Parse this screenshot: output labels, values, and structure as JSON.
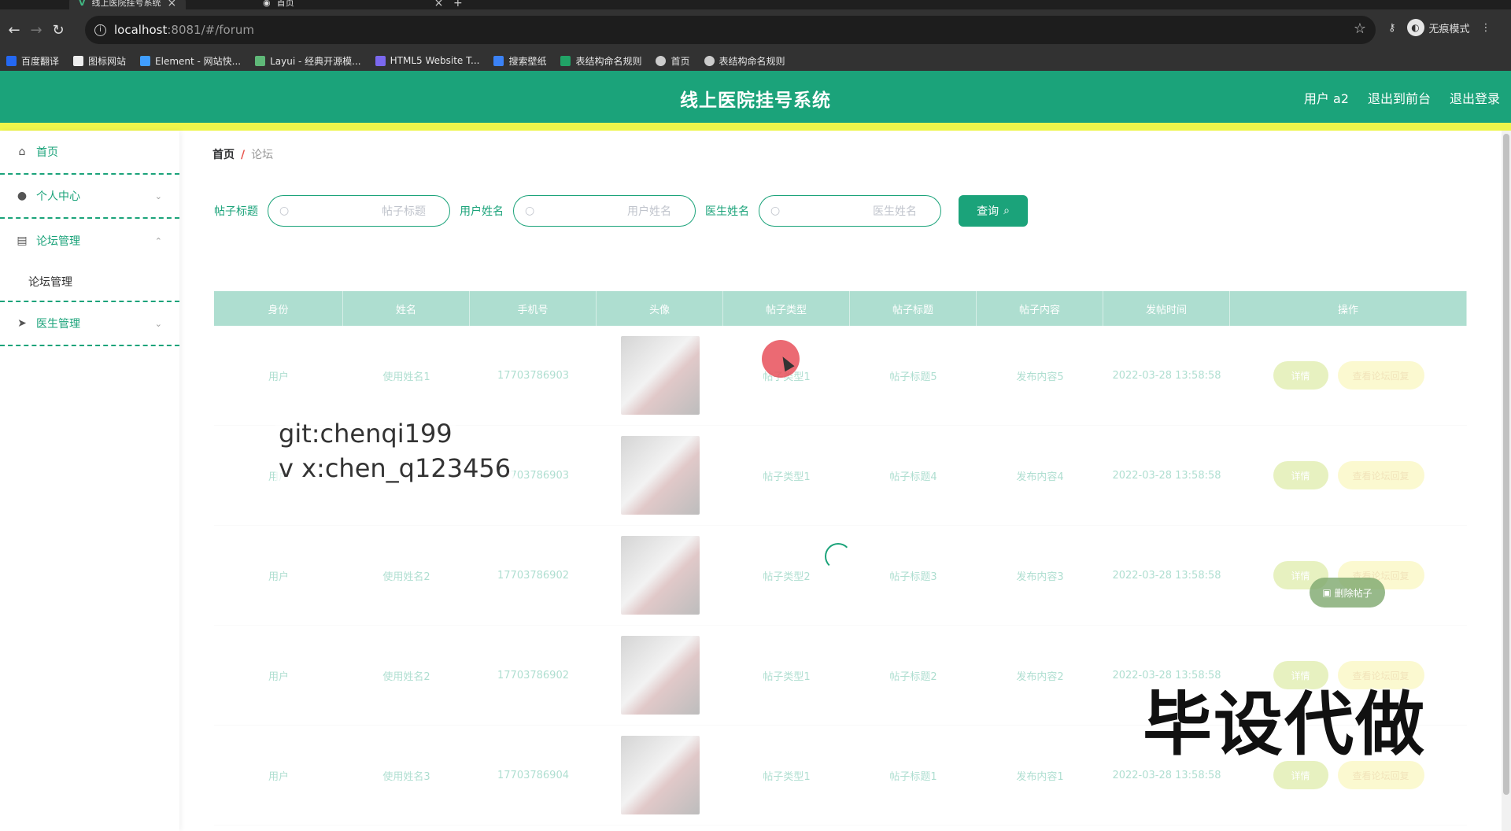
{
  "browser": {
    "tabs": [
      {
        "title": "线上医院挂号系统",
        "active": true
      },
      {
        "title": "首页",
        "active": false
      }
    ],
    "url_host": "localhost",
    "url_path": ":8081/#/forum",
    "incognito_label": "无痕模式",
    "bookmarks": [
      {
        "label": "百度翻译",
        "color": "#2468f2"
      },
      {
        "label": "图标网站",
        "color": "#eeeeee"
      },
      {
        "label": "Element - 网站快...",
        "color": "#409eff"
      },
      {
        "label": "Layui - 经典开源模...",
        "color": "#5fb878"
      },
      {
        "label": "HTML5 Website T...",
        "color": "#7b68ee"
      },
      {
        "label": "搜索壁纸",
        "color": "#3b82f6"
      },
      {
        "label": "表结构命名规则",
        "color": "#21a366"
      },
      {
        "label": "首页",
        "color": "#cccccc"
      },
      {
        "label": "表结构命名规则",
        "color": "#cccccc"
      }
    ]
  },
  "header": {
    "title": "线上医院挂号系统",
    "links": [
      "用户 a2",
      "退出到前台",
      "退出登录"
    ]
  },
  "sidebar": {
    "items": [
      {
        "label": "首页",
        "icon": "home-icon"
      },
      {
        "label": "个人中心",
        "icon": "user-icon"
      },
      {
        "label": "论坛管理",
        "icon": "forum-icon"
      },
      {
        "label": "论坛管理",
        "icon": ""
      },
      {
        "label": "医生管理",
        "icon": "send-icon"
      }
    ]
  },
  "breadcrumb": {
    "home": "首页",
    "separator": "/",
    "current": "论坛"
  },
  "search": {
    "fields": [
      {
        "label": "帖子标题",
        "placeholder": "帖子标题"
      },
      {
        "label": "用户姓名",
        "placeholder": "用户姓名"
      },
      {
        "label": "医生姓名",
        "placeholder": "医生姓名"
      }
    ],
    "button_label": "查询"
  },
  "table": {
    "columns": [
      "身份",
      "姓名",
      "手机号",
      "头像",
      "帖子类型",
      "帖子标题",
      "帖子内容",
      "发帖时间",
      "操作"
    ],
    "rows": [
      [
        "用户",
        "使用姓名1",
        "17703786903",
        "",
        "帖子类型1",
        "帖子标题5",
        "发布内容5",
        "2022-03-28 13:58:58",
        ""
      ],
      [
        "用户",
        "",
        "17703786903",
        "",
        "帖子类型1",
        "帖子标题4",
        "发布内容4",
        "2022-03-28 13:58:58",
        ""
      ],
      [
        "用户",
        "使用姓名2",
        "17703786902",
        "",
        "帖子类型2",
        "帖子标题3",
        "发布内容3",
        "2022-03-28 13:58:58",
        ""
      ],
      [
        "用户",
        "使用姓名2",
        "17703786902",
        "",
        "帖子类型1",
        "帖子标题2",
        "发布内容2",
        "2022-03-28 13:58:58",
        ""
      ],
      [
        "用户",
        "使用姓名3",
        "17703786904",
        "",
        "帖子类型1",
        "帖子标题1",
        "发布内容1",
        "2022-03-28 13:58:58",
        ""
      ]
    ],
    "detail_label": "详情",
    "comment_label": "查看论坛回复",
    "delete_label": "删除帖子"
  },
  "watermark": {
    "line1": "git:chenqi199",
    "line2": "v x:chen_q123456",
    "big": "毕设代做"
  },
  "colors": {
    "primary": "#1ba37a",
    "accent_yellow": "#eef54a"
  }
}
